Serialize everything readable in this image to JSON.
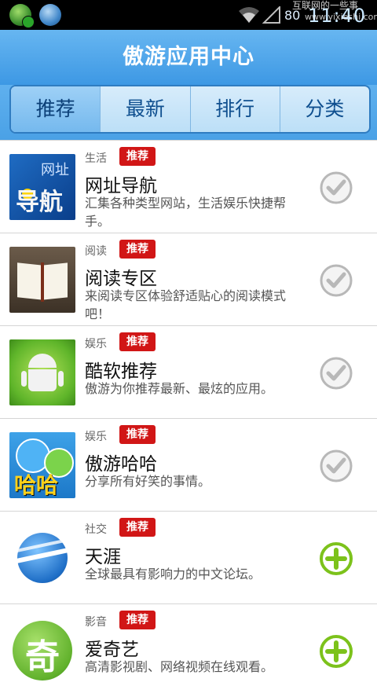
{
  "status_bar": {
    "battery_text": "80",
    "time": "11:40",
    "watermark_line1": "互联网的一些事",
    "watermark_line2": "www.yixieshi.com"
  },
  "header": {
    "title": "傲游应用中心"
  },
  "tabs": [
    {
      "label": "推荐",
      "selected": true
    },
    {
      "label": "最新",
      "selected": false
    },
    {
      "label": "排行",
      "selected": false
    },
    {
      "label": "分类",
      "selected": false
    }
  ],
  "apps": [
    {
      "category": "生活",
      "badge": "推荐",
      "name": "网址导航",
      "description": "汇集各种类型网站，生活娱乐快捷帮手。",
      "state": "installed",
      "icon": "web-nav-icon",
      "icon_text_small": "网址",
      "icon_text_big": "导航"
    },
    {
      "category": "阅读",
      "badge": "推荐",
      "name": "阅读专区",
      "description": "来阅读专区体验舒适贴心的阅读模式吧！",
      "state": "installed",
      "icon": "open-book-icon"
    },
    {
      "category": "娱乐",
      "badge": "推荐",
      "name": "酷软推荐",
      "description": "傲游为你推荐最新、最炫的应用。",
      "state": "installed",
      "icon": "android-robot-icon"
    },
    {
      "category": "娱乐",
      "badge": "推荐",
      "name": "傲游哈哈",
      "description": "分享所有好笑的事情。",
      "state": "installed",
      "icon": "laughing-faces-icon",
      "icon_text": "哈哈"
    },
    {
      "category": "社交",
      "badge": "推荐",
      "name": "天涯",
      "description": "全球最具有影响力的中文论坛。",
      "state": "add",
      "icon": "globe-icon"
    },
    {
      "category": "影音",
      "badge": "推荐",
      "name": "爱奇艺",
      "description": "高清影视剧、网络视频在线观看。",
      "state": "add",
      "icon": "iqiyi-icon",
      "icon_text": "奇"
    }
  ],
  "colors": {
    "header_blue": "#4aa1e6",
    "badge_red": "#d11616",
    "installed_check_gray": "#b8b8b8",
    "add_green": "#7cc21b"
  }
}
